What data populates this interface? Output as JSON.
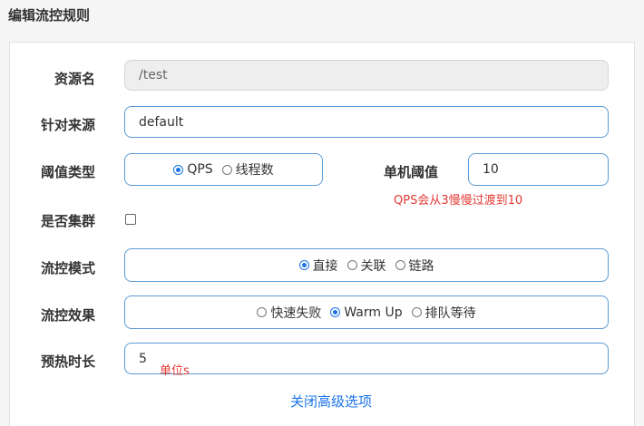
{
  "page": {
    "title": "编辑流控规则"
  },
  "form": {
    "resource": {
      "label": "资源名",
      "value": "/test"
    },
    "limit_app": {
      "label": "针对来源",
      "value": "default"
    },
    "threshold_type": {
      "label": "阈值类型",
      "options": [
        "QPS",
        "线程数"
      ],
      "selected": "QPS"
    },
    "single_threshold": {
      "label": "单机阈值",
      "value": "10"
    },
    "threshold_annotation": "QPS会从3慢慢过渡到10",
    "cluster": {
      "label": "是否集群",
      "checked": false
    },
    "flow_mode": {
      "label": "流控模式",
      "options": [
        "直接",
        "关联",
        "链路"
      ],
      "selected": "直接"
    },
    "flow_effect": {
      "label": "流控效果",
      "options": [
        "快速失败",
        "Warm Up",
        "排队等待"
      ],
      "selected": "Warm Up"
    },
    "warmup": {
      "label": "预热时长",
      "value": "5"
    },
    "warmup_annotation": "单位s",
    "advanced_link": "关闭高级选项"
  },
  "colors": {
    "accent": "#1a73e8",
    "border": "#5b9bd5",
    "annotation": "#e53935"
  }
}
